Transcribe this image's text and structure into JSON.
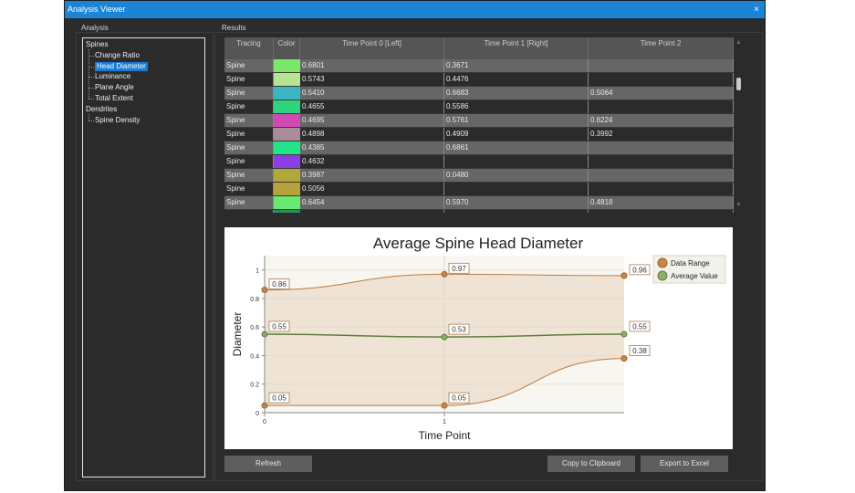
{
  "window": {
    "title": "Analysis Viewer",
    "close_glyph": "×"
  },
  "analysis": {
    "label": "Analysis",
    "tree": [
      {
        "label": "Spines",
        "level": 0,
        "selected": false
      },
      {
        "label": "Change Ratio",
        "level": 1,
        "selected": false
      },
      {
        "label": "Head Diameter",
        "level": 1,
        "selected": true
      },
      {
        "label": "Luminance",
        "level": 1,
        "selected": false
      },
      {
        "label": "Plane Angle",
        "level": 1,
        "selected": false
      },
      {
        "label": "Total Extent",
        "level": 1,
        "selected": false
      },
      {
        "label": "Dendrites",
        "level": 0,
        "selected": false
      },
      {
        "label": "Spine Density",
        "level": 1,
        "selected": false
      }
    ]
  },
  "results": {
    "label": "Results",
    "columns": [
      "Tracing",
      "Color",
      "Time Point 0 [Left]",
      "Time Point 1 [Right]",
      "Time Point 2"
    ],
    "rows": [
      {
        "tracing": "Spine",
        "color": "#7be86a",
        "tp0": "0.6801",
        "tp1": "0.3671",
        "tp2": ""
      },
      {
        "tracing": "Spine",
        "color": "#b6e494",
        "tp0": "0.5743",
        "tp1": "0.4476",
        "tp2": ""
      },
      {
        "tracing": "Spine",
        "color": "#3cb6c4",
        "tp0": "0.5410",
        "tp1": "0.6683",
        "tp2": "0.5064"
      },
      {
        "tracing": "Spine",
        "color": "#2fd47a",
        "tp0": "0.4655",
        "tp1": "0.5586",
        "tp2": ""
      },
      {
        "tracing": "Spine",
        "color": "#d04ab6",
        "tp0": "0.4695",
        "tp1": "0.5761",
        "tp2": "0.6224"
      },
      {
        "tracing": "Spine",
        "color": "#a88c9c",
        "tp0": "0.4898",
        "tp1": "0.4909",
        "tp2": "0.3992"
      },
      {
        "tracing": "Spine",
        "color": "#22e58a",
        "tp0": "0.4385",
        "tp1": "0.6861",
        "tp2": ""
      },
      {
        "tracing": "Spine",
        "color": "#8c3ee4",
        "tp0": "0.4632",
        "tp1": "",
        "tp2": ""
      },
      {
        "tracing": "Spine",
        "color": "#b0a83a",
        "tp0": "0.3987",
        "tp1": "0.0480",
        "tp2": ""
      },
      {
        "tracing": "Spine",
        "color": "#b8a23c",
        "tp0": "0.5056",
        "tp1": "",
        "tp2": ""
      },
      {
        "tracing": "Spine",
        "color": "#6ae872",
        "tp0": "0.6454",
        "tp1": "0.5970",
        "tp2": "0.4818"
      },
      {
        "tracing": "Spine",
        "color": "#2a8f60",
        "tp0": "",
        "tp1": "",
        "tp2": ""
      }
    ],
    "scroll_up": "▲",
    "scroll_down": "▼"
  },
  "chart_data": {
    "type": "line",
    "title": "Average Spine Head Diameter",
    "xlabel": "Time Point",
    "ylabel": "Diameter",
    "x": [
      0,
      1,
      2
    ],
    "xticks": [
      "0",
      "1"
    ],
    "yticks": [
      "0",
      "0.2",
      "0.4",
      "0.6",
      "0.8",
      "1"
    ],
    "ylim": [
      0,
      1.1
    ],
    "grid": true,
    "legend_position": "top-right",
    "series": [
      {
        "name": "Data Range",
        "upper": [
          0.86,
          0.97,
          0.96
        ],
        "lower": [
          0.05,
          0.05,
          0.38
        ],
        "color": "#c07a3a"
      },
      {
        "name": "Average Value",
        "values": [
          0.55,
          0.53,
          0.55
        ],
        "color": "#7fa05a"
      }
    ],
    "data_labels_upper": [
      "0.86",
      "0.97",
      "0.96"
    ],
    "data_labels_lower": [
      "0.05",
      "0.05",
      "0.38"
    ],
    "data_labels_avg": [
      "0.55",
      "0.53",
      "0.55"
    ]
  },
  "buttons": {
    "refresh": "Refresh",
    "copy": "Copy to Clipboard",
    "export": "Export to Excel"
  }
}
